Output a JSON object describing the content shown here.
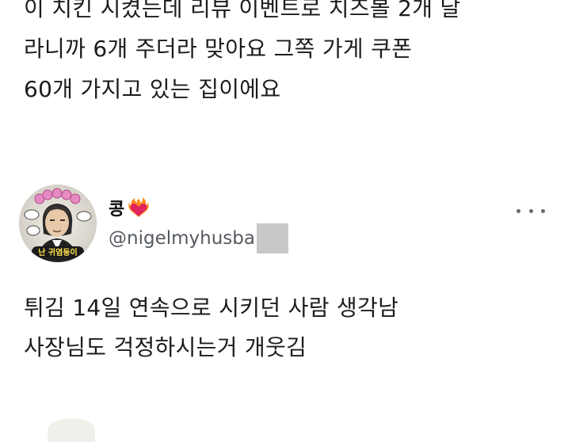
{
  "previous_tweet": {
    "lines": [
      "이 치킨 시켰는데 리뷰 이벤트로 치즈볼 2개 달",
      "라니까 6개 주더라 맞아요 그쪽 가게 쿠폰",
      "60개 가지고 있는 집이에요"
    ]
  },
  "tweet": {
    "display_name": "콩",
    "handle": "@nigelmyhusba",
    "text_lines": [
      "튀김 14일 연속으로 시키던 사람 생각남",
      "사장님도 걱정하시는거 개웃김"
    ]
  },
  "icons": {
    "name_emoji": "heart-on-fire-icon",
    "more": "more-options-icon"
  },
  "colors": {
    "text": "#1c1c1c",
    "handle": "#555a60",
    "censor": "#c8c8c8",
    "heart": "#e0245e"
  }
}
